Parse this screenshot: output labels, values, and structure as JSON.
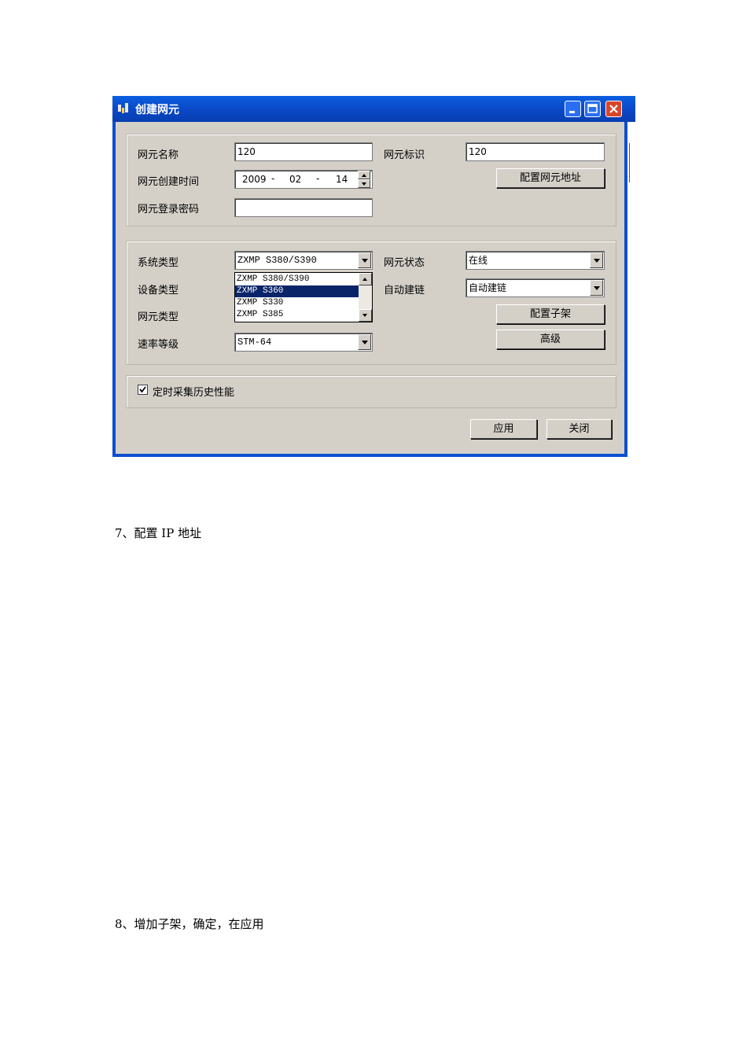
{
  "window": {
    "title": "创建网元",
    "icon": "network-element-icon",
    "controls": [
      "minimize-icon",
      "maximize-icon",
      "close-icon"
    ],
    "title_color": "#0a58dc"
  },
  "basic": {
    "name_label": "网元名称",
    "name_value": "120",
    "id_label": "网元标识",
    "id_value": "120",
    "created_label": "网元创建时间",
    "year": "2009",
    "month": "02",
    "day": "14",
    "sep1": "-",
    "sep2": "-",
    "config_address_button": "配置网元地址",
    "password_label": "网元登录密码",
    "password_value": ""
  },
  "types": {
    "system_label": "系统类型",
    "system_value": "ZXMP S380/S390",
    "device_label": "设备类型",
    "ne_type_label": "网元类型",
    "rate_label": "速率等级",
    "rate_value": "STM-64",
    "status_label": "网元状态",
    "status_value": "在线",
    "autolink_label": "自动建链",
    "autolink_value": "自动建链",
    "config_subrack_button": "配置子架",
    "advanced_button": "高级",
    "dropdown_options": [
      "ZXMP S380/S390",
      "ZXMP S360",
      "ZXMP S330",
      "ZXMP S385"
    ],
    "dropdown_selected": "ZXMP S360"
  },
  "perf": {
    "checked": true,
    "label": "定时采集历史性能"
  },
  "footer": {
    "apply_button": "应用",
    "close_button": "关闭"
  },
  "doc": {
    "step7": "7、配置 IP 地址",
    "step8": "8、增加子架，确定，在应用"
  }
}
